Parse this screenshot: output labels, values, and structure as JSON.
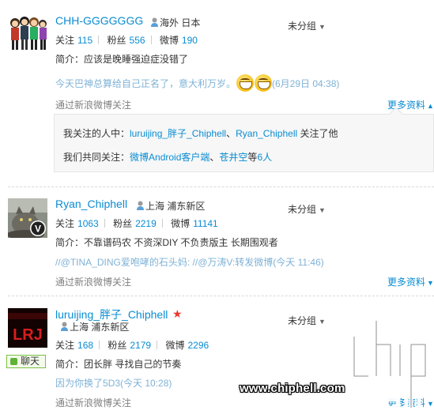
{
  "users": [
    {
      "name": "CHH-GGGGGGG",
      "location": "海外 日本",
      "group": "未分组",
      "stats": {
        "follow_label": "关注",
        "follow": "115",
        "fans_label": "粉丝",
        "fans": "556",
        "weibo_label": "微博",
        "weibo": "190"
      },
      "intro": "简介：应该是晚睡强迫症没错了",
      "latest_text": "今天巴神总算给自己正名了，意大利万岁。",
      "latest_time": "(6月29日 04:38)",
      "via": "通过新浪微博关注",
      "more": "更多资料"
    },
    {
      "name": "Ryan_Chiphell",
      "location": "上海 浦东新区",
      "group": "未分组",
      "stats": {
        "follow_label": "关注",
        "follow": "1063",
        "fans_label": "粉丝",
        "fans": "2219",
        "weibo_label": "微博",
        "weibo": "11141"
      },
      "intro": "简介：不靠谱码农 不资深DIY 不负责版主 长期围观者",
      "latest_text": "//@TINA_DING爱咆哮的石头妈: //@万涛V:转发微博",
      "latest_time": "(今天 11:46)",
      "via": "通过新浪微博关注",
      "more": "更多资料"
    },
    {
      "name": "luruijing_胖子_Chiphell",
      "location": "上海 浦东新区",
      "group": "未分组",
      "stats": {
        "follow_label": "关注",
        "follow": "168",
        "fans_label": "粉丝",
        "fans": "2179",
        "weibo_label": "微博",
        "weibo": "2296"
      },
      "intro": "简介：团长胖 寻找自己的节奏",
      "latest_text": "因为你换了5D3",
      "latest_time": "(今天 10:28)",
      "via": "通过新浪微博关注",
      "more": "更多资料",
      "chat_badge": "聊天",
      "avatar_text": "LRJ"
    }
  ],
  "relation": {
    "row1_prefix": "我关注的人中：",
    "row1_user1": "luruijing_胖子_Chiphell",
    "row1_comma": "、",
    "row1_user2": "Ryan_Chiphell",
    "row1_suffix": " 关注了他",
    "row2_prefix": "我们共同关注：",
    "row2_link1": "微博Android客户端",
    "row2_comma": "、",
    "row2_link2": "苍井空",
    "row2_mid": "等",
    "row2_count": "6人"
  },
  "watermark": {
    "url": "www.chiphell.com"
  },
  "colors": {
    "link": "#0a8cd2",
    "muted_link": "#7fb2d6",
    "gray": "#808080"
  }
}
